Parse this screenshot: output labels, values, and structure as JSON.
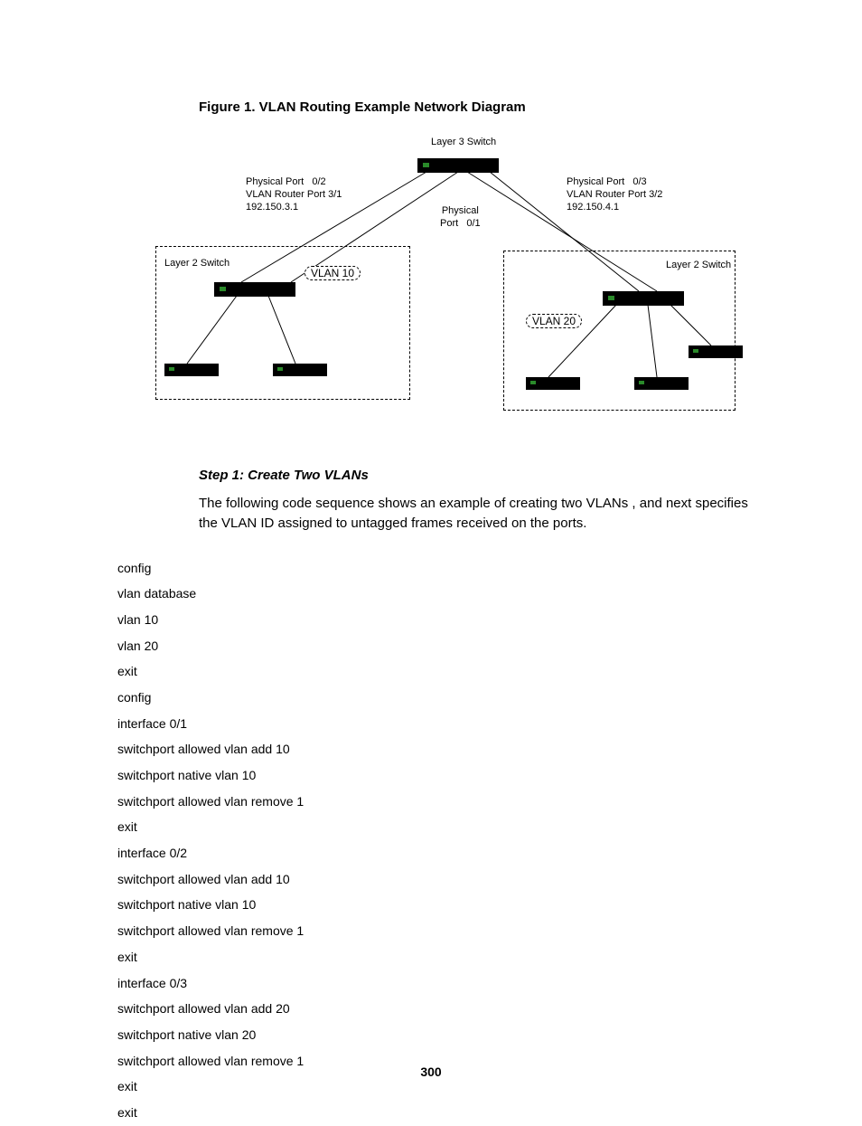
{
  "figure_title": "Figure 1. VLAN Routing Example Network Diagram",
  "diagram": {
    "l3_label": "Layer 3 Switch",
    "port_left": "Physical Port   0/2\nVLAN Router Port 3/1\n192.150.3.1",
    "port_mid": "Physical\nPort   0/1",
    "port_right": "Physical Port   0/3\nVLAN Router Port 3/2\n192.150.4.1",
    "l2_left": "Layer 2 Switch",
    "l2_right": "Layer 2 Switch",
    "vlan_left": "VLAN 10",
    "vlan_right": "VLAN 20"
  },
  "step_title": "Step 1: Create Two VLANs",
  "step_desc": "The following code sequence shows an example of creating two VLANs , and next specifies the VLAN ID assigned to untagged frames received on the ports.",
  "code": [
    "config",
    "vlan database",
    "vlan 10",
    "vlan 20",
    "exit",
    "config",
    "interface 0/1",
    "switchport allowed vlan add 10",
    "switchport native vlan 10",
    "switchport allowed vlan remove 1",
    "exit",
    "interface 0/2",
    "switchport allowed vlan add 10",
    "switchport native vlan 10",
    "switchport allowed vlan remove 1",
    "exit",
    "interface 0/3",
    "switchport allowed vlan add 20",
    "switchport native vlan 20",
    "switchport allowed vlan remove 1",
    "exit",
    "exit"
  ],
  "page_number": "300"
}
